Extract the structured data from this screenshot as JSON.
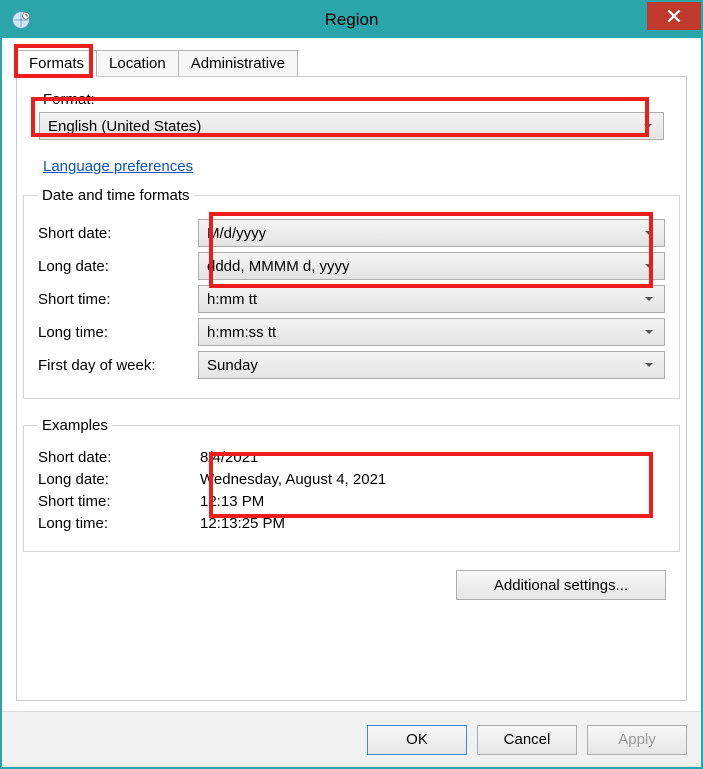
{
  "window": {
    "title": "Region"
  },
  "tabs": {
    "formats": "Formats",
    "location": "Location",
    "administrative": "Administrative"
  },
  "format": {
    "label": "Format:",
    "value": "English (United States)"
  },
  "link": {
    "language_prefs": "Language preferences"
  },
  "groups": {
    "date_time": "Date and time formats",
    "examples": "Examples"
  },
  "dt": {
    "short_date": {
      "label": "Short date:",
      "value": "M/d/yyyy"
    },
    "long_date": {
      "label": "Long date:",
      "value": "dddd, MMMM d, yyyy"
    },
    "short_time": {
      "label": "Short time:",
      "value": "h:mm tt"
    },
    "long_time": {
      "label": "Long time:",
      "value": "h:mm:ss tt"
    },
    "first_day": {
      "label": "First day of week:",
      "value": "Sunday"
    }
  },
  "ex": {
    "short_date": {
      "label": "Short date:",
      "value": "8/4/2021"
    },
    "long_date": {
      "label": "Long date:",
      "value": "Wednesday, August 4, 2021"
    },
    "short_time": {
      "label": "Short time:",
      "value": "12:13 PM"
    },
    "long_time": {
      "label": "Long time:",
      "value": "12:13:25 PM"
    }
  },
  "buttons": {
    "additional": "Additional settings...",
    "ok": "OK",
    "cancel": "Cancel",
    "apply": "Apply"
  },
  "icons": {
    "close": "close-icon",
    "clock": "clock-globa-icon",
    "chevron": "chevron-down"
  }
}
